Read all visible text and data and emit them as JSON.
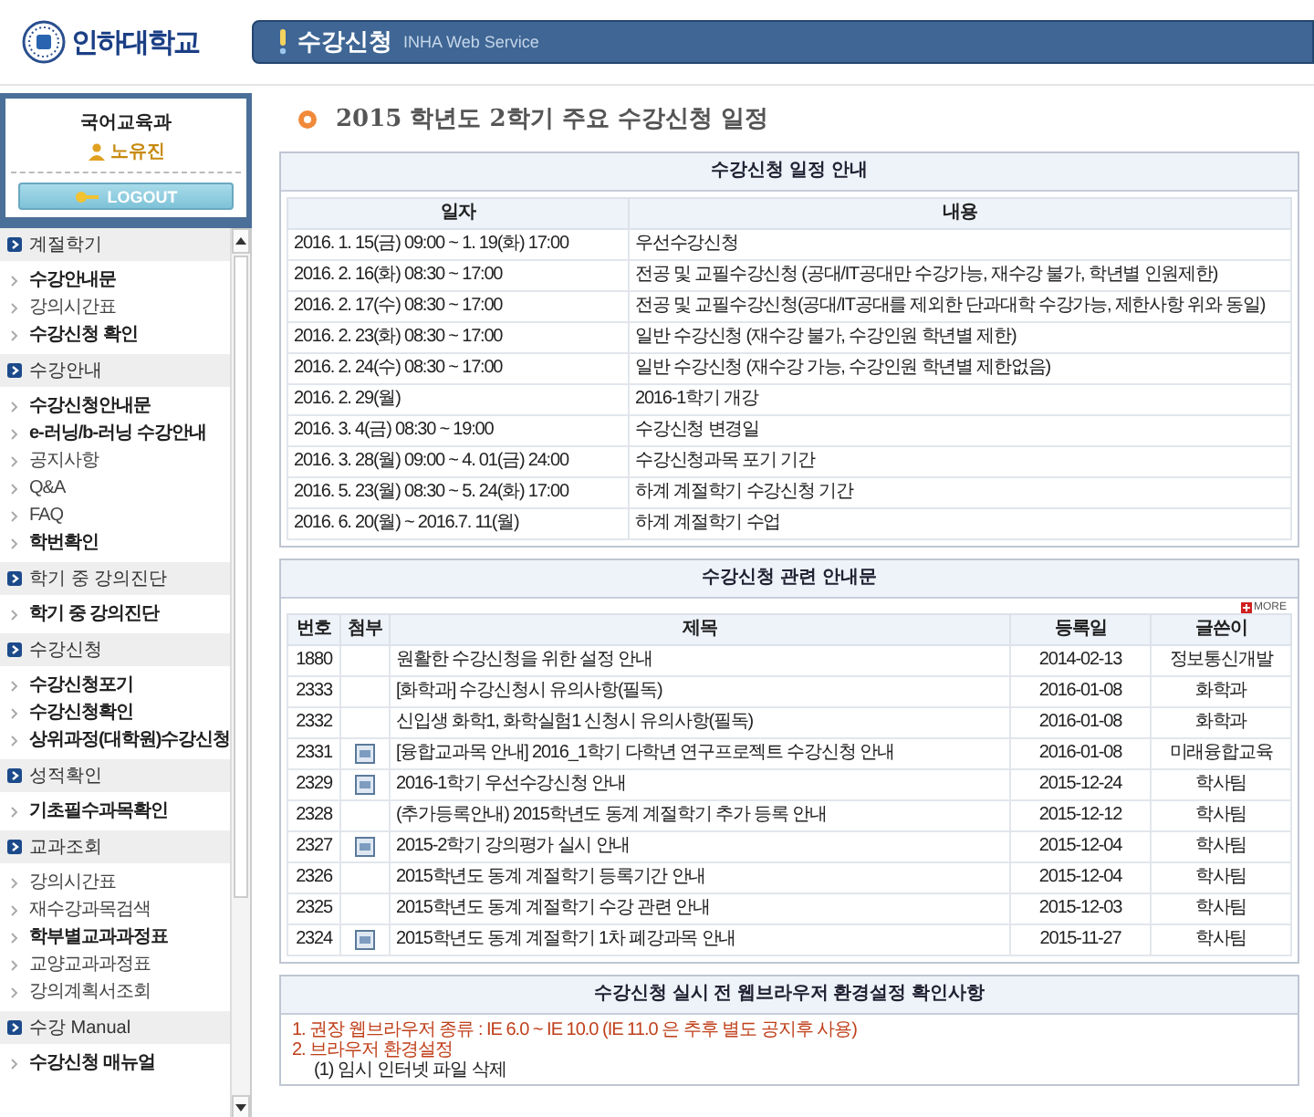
{
  "logo": {
    "name": "인하대학교"
  },
  "header": {
    "title": "수강신청",
    "subtitle": "INHA Web Service"
  },
  "user": {
    "department": "국어교육과",
    "name": "노유진",
    "logout": "LOGOUT"
  },
  "sidebar": {
    "sections": [
      {
        "title": "계절학기",
        "items": [
          {
            "label": "수강안내문",
            "bold": true
          },
          {
            "label": "강의시간표",
            "bold": false
          },
          {
            "label": "수강신청 확인",
            "bold": true
          }
        ]
      },
      {
        "title": "수강안내",
        "items": [
          {
            "label": "수강신청안내문",
            "bold": true
          },
          {
            "label": "e-러닝/b-러닝 수강안내",
            "bold": true
          },
          {
            "label": "공지사항",
            "bold": false
          },
          {
            "label": "Q&A",
            "bold": false
          },
          {
            "label": "FAQ",
            "bold": false
          },
          {
            "label": "학번확인",
            "bold": true
          }
        ]
      },
      {
        "title": "학기 중 강의진단",
        "items": [
          {
            "label": "학기 중 강의진단",
            "bold": true
          }
        ]
      },
      {
        "title": "수강신청",
        "items": [
          {
            "label": "수강신청포기",
            "bold": true
          },
          {
            "label": "수강신청확인",
            "bold": true
          },
          {
            "label": "상위과정(대학원)수강신청",
            "bold": true
          }
        ]
      },
      {
        "title": "성적확인",
        "items": [
          {
            "label": "기초필수과목확인",
            "bold": true
          }
        ]
      },
      {
        "title": "교과조회",
        "items": [
          {
            "label": "강의시간표",
            "bold": false
          },
          {
            "label": "재수강과목검색",
            "bold": false
          },
          {
            "label": "학부별교과과정표",
            "bold": true
          },
          {
            "label": "교양교과과정표",
            "bold": false
          },
          {
            "label": "강의계획서조회",
            "bold": false
          }
        ]
      },
      {
        "title": "수강 Manual",
        "items": [
          {
            "label": "수강신청 매뉴얼",
            "bold": true
          }
        ]
      }
    ]
  },
  "page_title": "2015 학년도 2학기 주요 수강신청 일정",
  "schedule": {
    "title": "수강신청 일정 안내",
    "columns": [
      "일자",
      "내용"
    ],
    "rows": [
      [
        "2016. 1. 15(금) 09:00 ~ 1. 19(화) 17:00",
        "우선수강신청"
      ],
      [
        "2016. 2. 16(화) 08:30 ~ 17:00",
        "전공 및 교필수강신청 (공대/IT공대만 수강가능, 재수강 불가, 학년별 인원제한)"
      ],
      [
        "2016. 2. 17(수) 08:30 ~ 17:00",
        "전공 및 교필수강신청(공대/IT공대를 제외한 단과대학 수강가능, 제한사항 위와 동일)"
      ],
      [
        "2016. 2. 23(화) 08:30 ~ 17:00",
        "일반 수강신청 (재수강 불가, 수강인원 학년별 제한)"
      ],
      [
        "2016. 2. 24(수) 08:30 ~ 17:00",
        "일반 수강신청 (재수강 가능, 수강인원 학년별 제한없음)"
      ],
      [
        "2016. 2. 29(월)",
        "2016-1학기 개강"
      ],
      [
        "2016. 3. 4(금) 08:30 ~ 19:00",
        "수강신청 변경일"
      ],
      [
        "2016. 3. 28(월) 09:00 ~ 4. 01(금) 24:00",
        "수강신청과목 포기 기간"
      ],
      [
        "2016. 5. 23(월) 08:30 ~ 5. 24(화) 17:00",
        "하계 계절학기 수강신청 기간"
      ],
      [
        "2016. 6. 20(월) ~ 2016.7. 11(월)",
        "하계 계절학기 수업"
      ]
    ]
  },
  "notices": {
    "title": "수강신청 관련 안내문",
    "more": "MORE",
    "columns": [
      "번호",
      "첨부",
      "제목",
      "등록일",
      "글쓴이"
    ],
    "rows": [
      {
        "no": "1880",
        "attachment": false,
        "subject": "원활한 수강신청을 위한 설정 안내",
        "date": "2014-02-13",
        "author": "정보통신개발"
      },
      {
        "no": "2333",
        "attachment": false,
        "subject": "[화학과] 수강신청시 유의사항(필독)",
        "date": "2016-01-08",
        "author": "화학과"
      },
      {
        "no": "2332",
        "attachment": false,
        "subject": "신입생 화학1, 화학실험1 신청시 유의사항(필독)",
        "date": "2016-01-08",
        "author": "화학과"
      },
      {
        "no": "2331",
        "attachment": true,
        "subject": "[융합교과목 안내] 2016_1학기 다학년 연구프로젝트 수강신청 안내",
        "date": "2016-01-08",
        "author": "미래융합교육"
      },
      {
        "no": "2329",
        "attachment": true,
        "subject": "2016-1학기 우선수강신청 안내",
        "date": "2015-12-24",
        "author": "학사팀"
      },
      {
        "no": "2328",
        "attachment": false,
        "subject": "(추가등록안내) 2015학년도 동계 계절학기 추가 등록 안내",
        "date": "2015-12-12",
        "author": "학사팀"
      },
      {
        "no": "2327",
        "attachment": true,
        "subject": "2015-2학기 강의평가 실시 안내",
        "date": "2015-12-04",
        "author": "학사팀"
      },
      {
        "no": "2326",
        "attachment": false,
        "subject": "2015학년도 동계 계절학기 등록기간 안내",
        "date": "2015-12-04",
        "author": "학사팀"
      },
      {
        "no": "2325",
        "attachment": false,
        "subject": "2015학년도 동계 계절학기 수강 관련 안내",
        "date": "2015-12-03",
        "author": "학사팀"
      },
      {
        "no": "2324",
        "attachment": true,
        "subject": "2015학년도 동계 계절학기 1차 폐강과목 안내",
        "date": "2015-11-27",
        "author": "학사팀"
      }
    ]
  },
  "browser": {
    "title": "수강신청 실시 전 웹브라우저 환경설정 확인사항",
    "lines": [
      {
        "kind": "highlight",
        "text": "1. 권장 웹브라우저 종류 : IE 6.0 ~ IE 10.0 (IE 11.0 은 추후 별도 공지후 사용)"
      },
      {
        "kind": "highlight",
        "text": "2. 브라우저 환경설정"
      },
      {
        "kind": "sub",
        "text": "(1) 임시 인터넷 파일 삭제"
      }
    ]
  }
}
